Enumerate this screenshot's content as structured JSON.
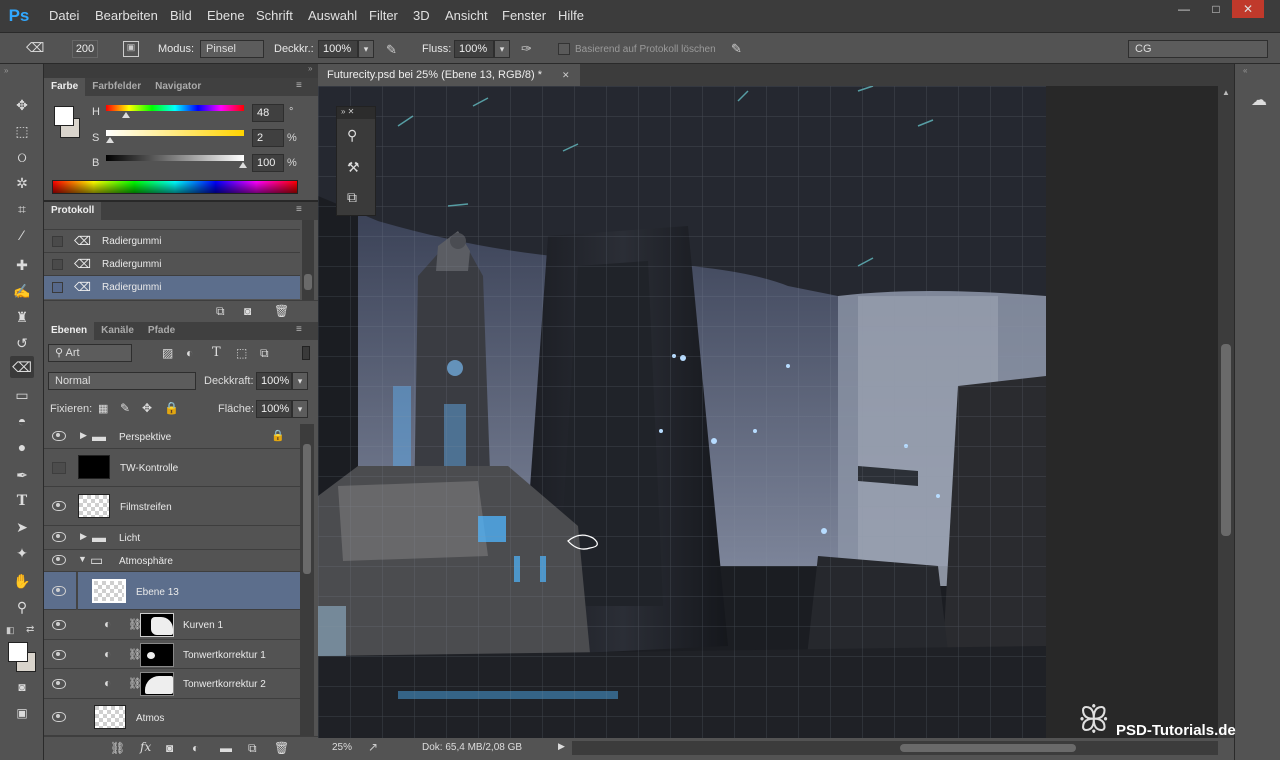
{
  "app": {
    "logo": "Ps"
  },
  "menu": [
    "Datei",
    "Bearbeiten",
    "Bild",
    "Ebene",
    "Schrift",
    "Auswahl",
    "Filter",
    "3D",
    "Ansicht",
    "Fenster",
    "Hilfe"
  ],
  "window_controls": {
    "minimize": "—",
    "maximize": "□",
    "close": "✕"
  },
  "options": {
    "brush_size": "200",
    "modus_label": "Modus:",
    "modus_value": "Pinsel",
    "deckkr_label": "Deckkr.:",
    "deckkr_value": "100%",
    "fluss_label": "Fluss:",
    "fluss_value": "100%",
    "protokoll_label": "Basierend auf Protokoll löschen",
    "workspace": "CG"
  },
  "document": {
    "tab_title": "Futurecity.psd bei 25% (Ebene 13, RGB/8) *",
    "close": "✕"
  },
  "color_panel": {
    "tabs": [
      "Farbe",
      "Farbfelder",
      "Navigator"
    ],
    "h_label": "H",
    "h_value": "48",
    "h_unit": "°",
    "s_label": "S",
    "s_value": "2",
    "s_unit": "%",
    "b_label": "B",
    "b_value": "100",
    "b_unit": "%"
  },
  "history_panel": {
    "tab": "Protokoll",
    "items": [
      "Radiergummi",
      "Radiergummi",
      "Radiergummi"
    ]
  },
  "layers_panel": {
    "tabs": [
      "Ebenen",
      "Kanäle",
      "Pfade"
    ],
    "filter_label": "Art",
    "blend_mode": "Normal",
    "opacity_label": "Deckkraft:",
    "opacity_value": "100%",
    "lock_label": "Fixieren:",
    "fill_label": "Fläche:",
    "fill_value": "100%",
    "layers": [
      "Perspektive",
      "TW-Kontrolle",
      "Filmstreifen",
      "Licht",
      "Atmosphäre",
      "Ebene 13",
      "Kurven 1",
      "Tonwertkorrektur 1",
      "Tonwertkorrektur 2",
      "Atmos"
    ]
  },
  "status": {
    "zoom": "25%",
    "doc_info": "Dok: 65,4 MB/2,08 GB"
  },
  "watermark": "PSD-Tutorials.de",
  "colors": {
    "accent": "#31a8ff",
    "selected_row": "#5c6e8c",
    "panel_bg": "#535353",
    "dark_bg": "#282828"
  }
}
